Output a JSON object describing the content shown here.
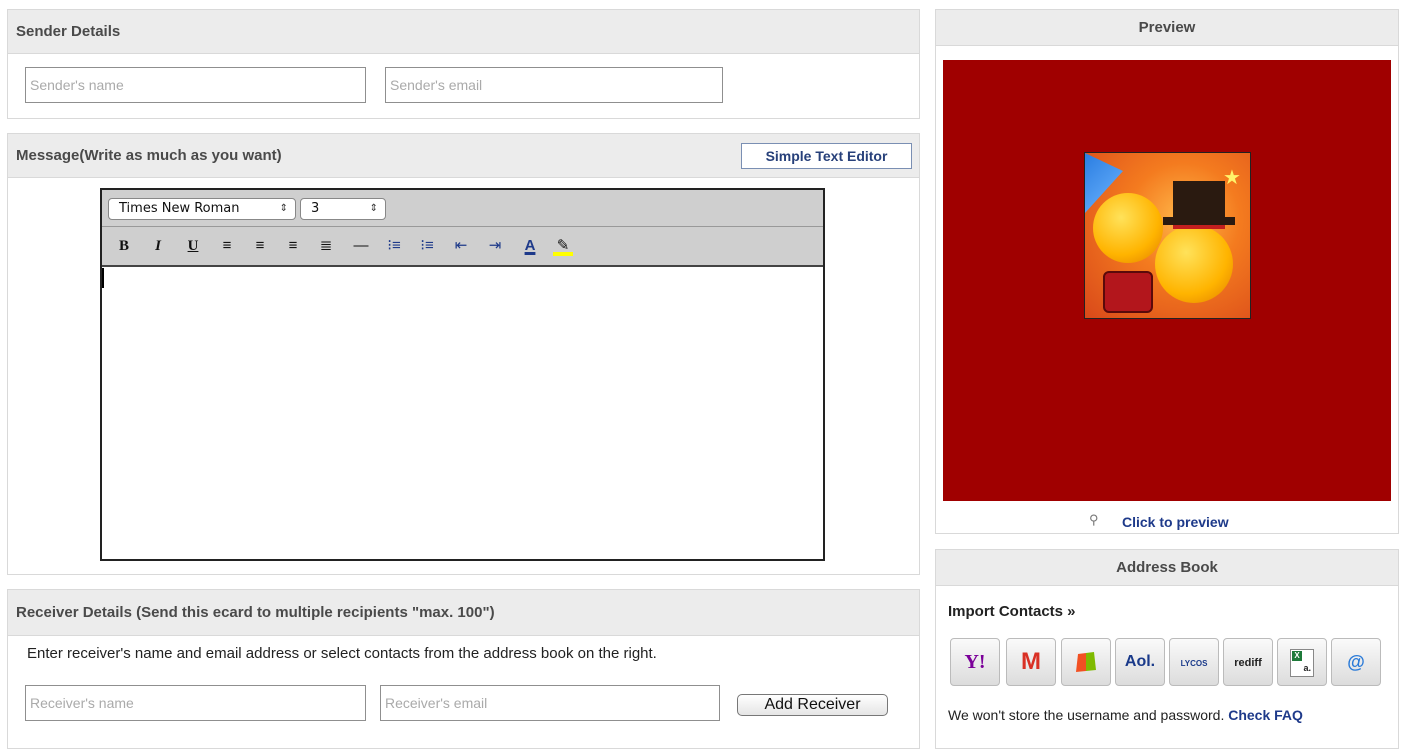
{
  "sender": {
    "title": "Sender Details",
    "name_placeholder": "Sender's name",
    "email_placeholder": "Sender's email"
  },
  "message": {
    "title": "Message(Write as much as you want)",
    "simple_editor_label": "Simple Text Editor",
    "font_family": "Times New Roman",
    "font_size": "3",
    "toolbar_icons": [
      "bold-icon",
      "italic-icon",
      "underline-icon",
      "align-left-icon",
      "align-center-icon",
      "align-right-icon",
      "justify-icon",
      "horizontal-rule-icon",
      "ordered-list-icon",
      "unordered-list-icon",
      "outdent-icon",
      "indent-icon",
      "text-color-icon",
      "highlight-color-icon"
    ]
  },
  "receiver": {
    "title": "Receiver Details (Send this ecard to multiple recipients \"max. 100\")",
    "instructions": "Enter receiver's name and email address or select contacts from the address book on the right.",
    "name_placeholder": "Receiver's name",
    "email_placeholder": "Receiver's email",
    "add_button": "Add Receiver"
  },
  "preview": {
    "title": "Preview",
    "click_label": "Click to preview",
    "background_color": "#a00000"
  },
  "address_book": {
    "title": "Address Book",
    "import_label": "Import Contacts »",
    "providers": [
      {
        "name": "yahoo",
        "label": "Y!",
        "color": "#7b0099"
      },
      {
        "name": "gmail",
        "label": "M",
        "color": "#d93025"
      },
      {
        "name": "windows",
        "label": "",
        "color": "#2b7bd8"
      },
      {
        "name": "aol",
        "label": "Aol.",
        "color": "#1a3a8a"
      },
      {
        "name": "lycos",
        "label": "LYCOS",
        "color": "#1a3a8a"
      },
      {
        "name": "rediff",
        "label": "rediff",
        "color": "#222222"
      },
      {
        "name": "excel",
        "label": "a.",
        "color": "#1e7a3a"
      },
      {
        "name": "email",
        "label": "@",
        "color": "#2b7bd8"
      }
    ],
    "notice": "We won't store the username and password.",
    "faq_link": "Check FAQ"
  }
}
